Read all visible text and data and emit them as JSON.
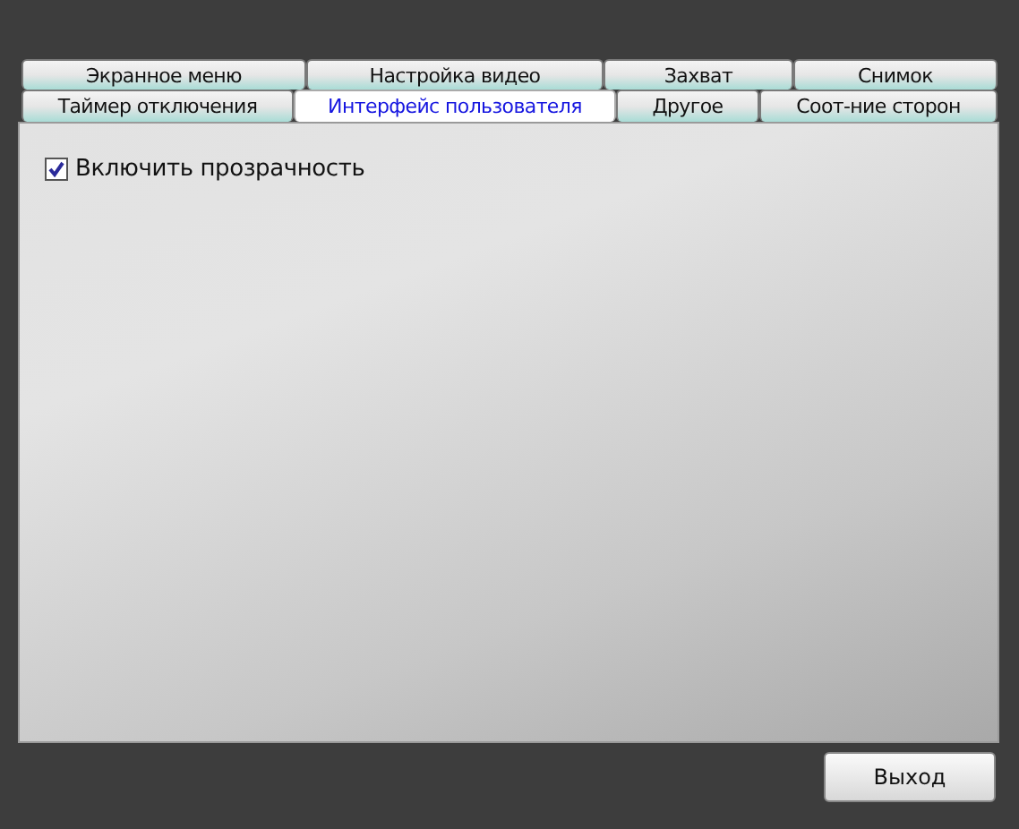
{
  "tab_rows": [
    [
      {
        "label": "Экранное меню",
        "selected": false
      },
      {
        "label": "Настройка видео",
        "selected": false
      },
      {
        "label": "Захват",
        "selected": false
      },
      {
        "label": "Снимок",
        "selected": false
      }
    ],
    [
      {
        "label": "Таймер отключения",
        "selected": false
      },
      {
        "label": "Интерфейс пользователя",
        "selected": true
      },
      {
        "label": "Другое",
        "selected": false
      },
      {
        "label": "Соот-ние сторон",
        "selected": false
      }
    ]
  ],
  "options": [
    {
      "label": "Включить прозрачность",
      "checked": true
    }
  ],
  "buttons": [
    "Выход"
  ]
}
